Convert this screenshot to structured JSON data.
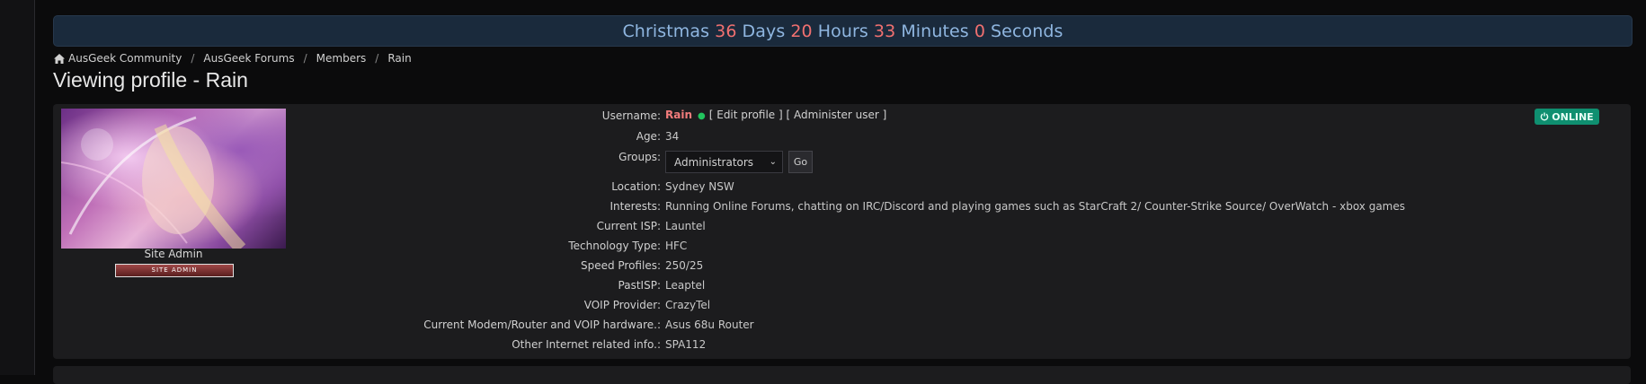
{
  "countdown": {
    "event": "Christmas",
    "days": "36",
    "days_label": "Days",
    "hours": "20",
    "hours_label": "Hours",
    "minutes": "33",
    "minutes_label": "Minutes",
    "seconds": "0",
    "seconds_label": "Seconds"
  },
  "breadcrumb": [
    "AusGeek Community",
    "AusGeek Forums",
    "Members",
    "Rain"
  ],
  "page_title": "Viewing profile - Rain",
  "profile": {
    "rank_title": "Site Admin",
    "rank_badge": "SITE ADMIN",
    "online_badge": "ONLINE",
    "username_label": "Username:",
    "username": "Rain",
    "edit_profile": "[ Edit profile ]",
    "administer_user": "[ Administer user ]",
    "age_label": "Age:",
    "age": "34",
    "groups_label": "Groups:",
    "groups_selected": "Administrators",
    "go_label": "Go",
    "fields": [
      {
        "label": "Location:",
        "value": "Sydney NSW"
      },
      {
        "label": "Interests:",
        "value": "Running Online Forums, chatting on IRC/Discord and playing games such as StarCraft 2/ Counter-Strike Source/ OverWatch - xbox games"
      },
      {
        "label": "Current ISP:",
        "value": "Launtel"
      },
      {
        "label": "Technology Type:",
        "value": "HFC"
      },
      {
        "label": "Speed Profiles:",
        "value": "250/25"
      },
      {
        "label": "PastISP:",
        "value": "Leaptel"
      },
      {
        "label": "VOIP Provider:",
        "value": "CrazyTel"
      },
      {
        "label": "Current Modem/Router and VOIP hardware.:",
        "value": "Asus 68u Router"
      },
      {
        "label": "Other Internet related info.:",
        "value": "SPA112"
      }
    ]
  },
  "colors": {
    "background": "#0b0b0c",
    "panel": "#1c1c1e",
    "banner": "#1a2a3c",
    "accent_number": "#f07070",
    "username": "#f27c7c",
    "online": "#0f8f70"
  }
}
